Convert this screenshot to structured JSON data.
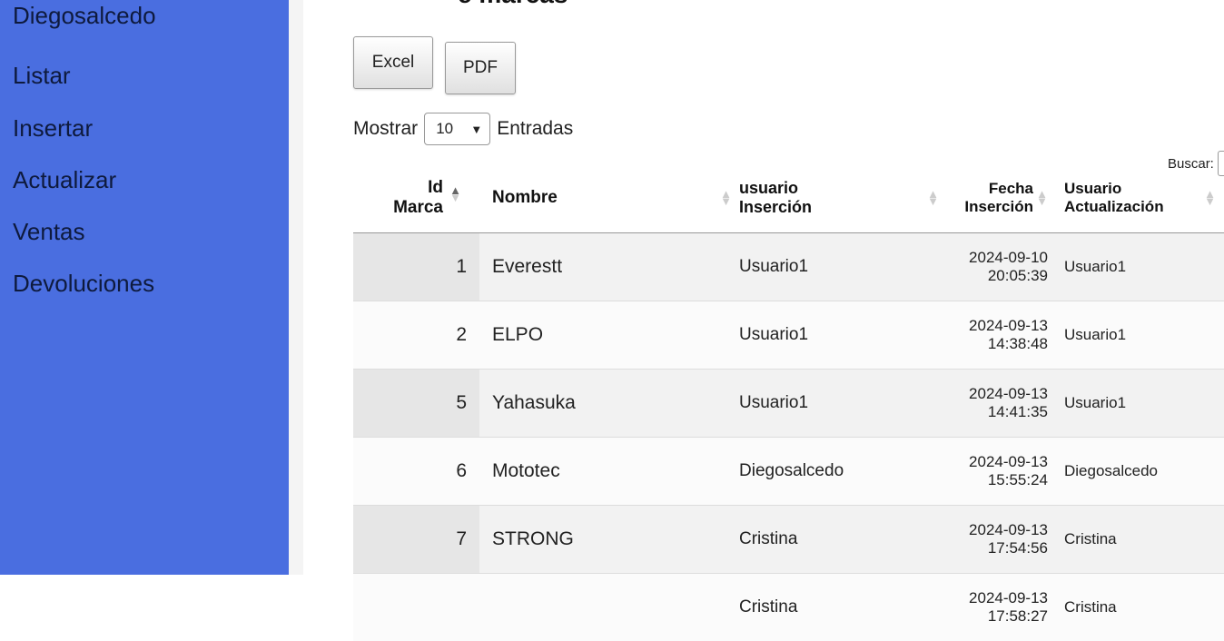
{
  "sidebar": {
    "user": "Diegosalcedo",
    "items": [
      {
        "label": "Listar"
      },
      {
        "label": "Insertar"
      },
      {
        "label": "Actualizar"
      },
      {
        "label": "Ventas"
      },
      {
        "label": "Devoluciones"
      }
    ]
  },
  "page": {
    "title": "e marcas"
  },
  "buttons": {
    "excel": "Excel",
    "pdf": "PDF"
  },
  "length": {
    "before": "Mostrar",
    "value": "10",
    "after": "Entradas"
  },
  "search": {
    "label": "Buscar:"
  },
  "table": {
    "headers": {
      "id_line1": "Id",
      "id_line2": "Marca",
      "name": "Nombre",
      "uins_line1": "usuario",
      "uins_line2": "Inserción",
      "fecha_line1": "Fecha",
      "fecha_line2": "Inserción",
      "uact_line1": "Usuario",
      "uact_line2": "Actualización"
    },
    "rows": [
      {
        "id": "1",
        "name": "Everestt",
        "uins": "Usuario1",
        "date": "2024-09-10",
        "time": "20:05:39",
        "uact": "Usuario1"
      },
      {
        "id": "2",
        "name": "ELPO",
        "uins": "Usuario1",
        "date": "2024-09-13",
        "time": "14:38:48",
        "uact": "Usuario1"
      },
      {
        "id": "5",
        "name": "Yahasuka",
        "uins": "Usuario1",
        "date": "2024-09-13",
        "time": "14:41:35",
        "uact": "Usuario1"
      },
      {
        "id": "6",
        "name": "Mototec",
        "uins": "Diegosalcedo",
        "date": "2024-09-13",
        "time": "15:55:24",
        "uact": "Diegosalcedo"
      },
      {
        "id": "7",
        "name": "STRONG",
        "uins": "Cristina",
        "date": "2024-09-13",
        "time": "17:54:56",
        "uact": "Cristina"
      },
      {
        "id": "",
        "name": "",
        "uins": "Cristina",
        "date": "2024-09-13",
        "time": "17:58:27",
        "uact": "Cristina"
      }
    ]
  },
  "colors": {
    "sidebar_bg": "#4a6ee0",
    "sidebar_text": "#0e1a3d"
  }
}
